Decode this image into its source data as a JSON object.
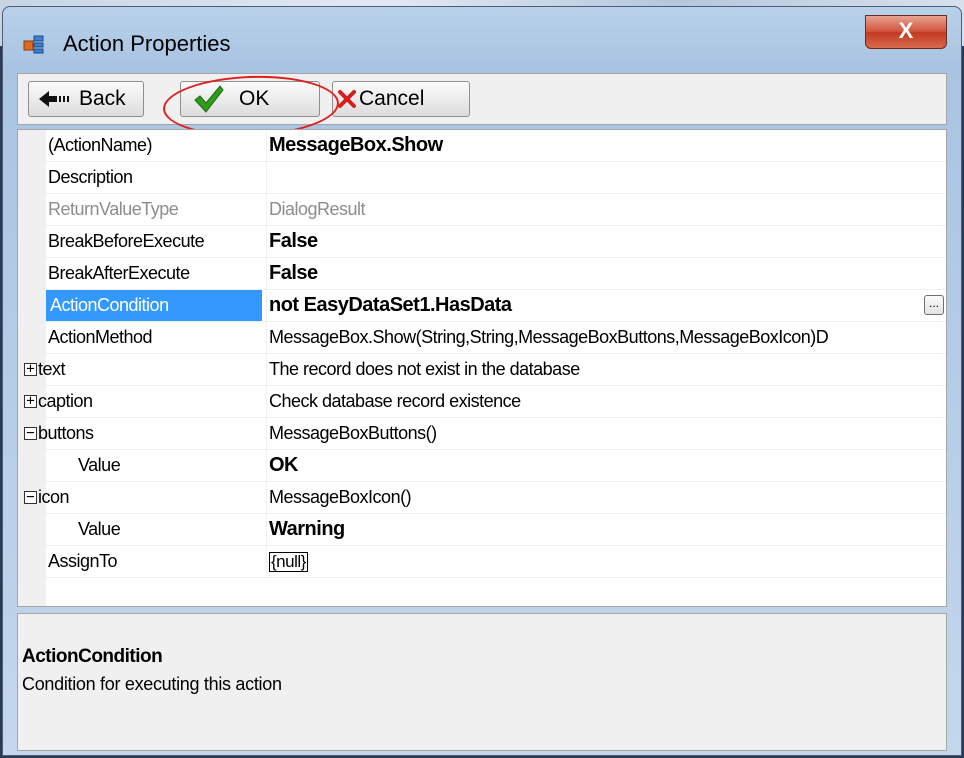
{
  "window": {
    "title": "Action Properties",
    "close_label": "X"
  },
  "toolbar": {
    "back_label": "Back",
    "ok_label": "OK",
    "cancel_label": "Cancel",
    "highlight_color": "#e02020"
  },
  "grid": {
    "rows": [
      {
        "label": "(ActionName)",
        "value": "MessageBox.Show"
      },
      {
        "label": "Description",
        "value": ""
      },
      {
        "label": "ReturnValueType",
        "value": "DialogResult"
      },
      {
        "label": "BreakBeforeExecute",
        "value": "False"
      },
      {
        "label": "BreakAfterExecute",
        "value": "False"
      },
      {
        "label": "ActionCondition",
        "value": "not EasyDataSet1.HasData",
        "ellipsis": "..."
      },
      {
        "label": "ActionMethod",
        "value": "MessageBox.Show(String,String,MessageBoxButtons,MessageBoxIcon)D"
      },
      {
        "label": "text",
        "value": "The record does not exist in the database",
        "toggle": "+"
      },
      {
        "label": "caption",
        "value": "Check database record existence",
        "toggle": "+"
      },
      {
        "label": "buttons",
        "value": "MessageBoxButtons()",
        "toggle": "−"
      },
      {
        "label": "Value",
        "value": "OK"
      },
      {
        "label": "icon",
        "value": "MessageBoxIcon()",
        "toggle": "−"
      },
      {
        "label": "Value",
        "value": "Warning"
      },
      {
        "label": "AssignTo",
        "value": "{null}"
      }
    ],
    "selection_color": "#3399ff"
  },
  "help": {
    "title": "ActionCondition",
    "description": "Condition for executing this action"
  }
}
